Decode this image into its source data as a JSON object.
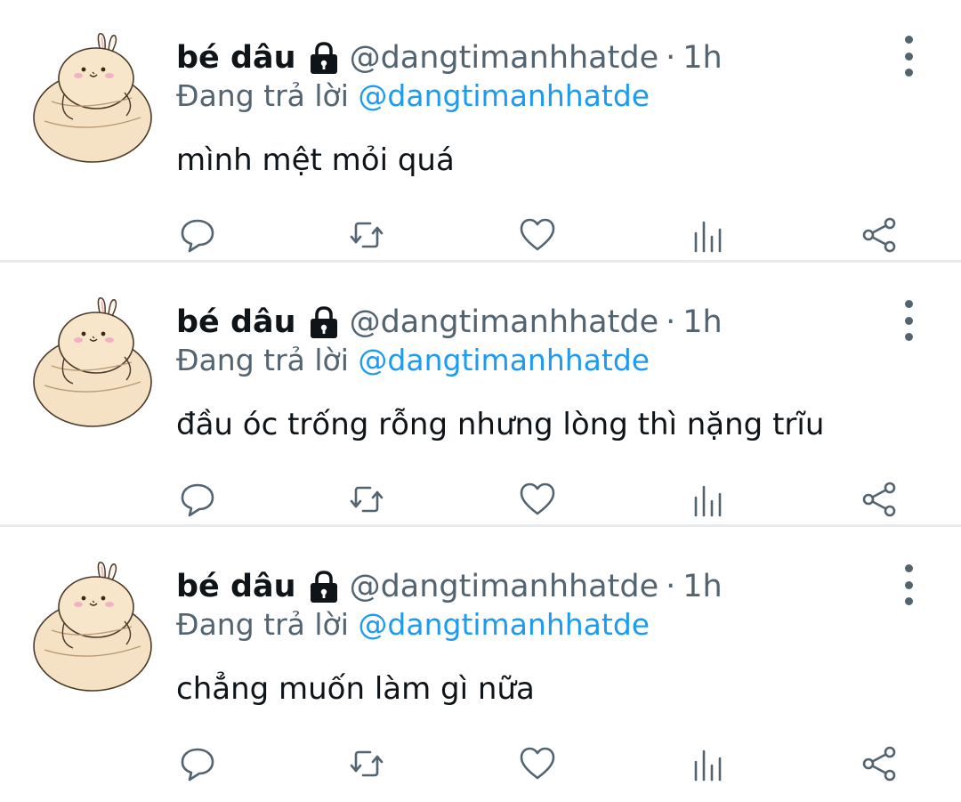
{
  "colors": {
    "text": "#0f1419",
    "secondary": "#536471",
    "link": "#1d9bf0",
    "divider": "#e7e9eb"
  },
  "tweets": [
    {
      "display_name": "bé dâu",
      "handle": "@dangtimanhhatde",
      "separator": "·",
      "time": "1h",
      "reply_prefix": "Đang trả lời",
      "reply_to": "@dangtimanhhatde",
      "text": "mình mệt mỏi quá"
    },
    {
      "display_name": "bé dâu",
      "handle": "@dangtimanhhatde",
      "separator": "·",
      "time": "1h",
      "reply_prefix": "Đang trả lời",
      "reply_to": "@dangtimanhhatde",
      "text": "đầu óc trống rỗng nhưng lòng thì nặng trĩu"
    },
    {
      "display_name": "bé dâu",
      "handle": "@dangtimanhhatde",
      "separator": "·",
      "time": "1h",
      "reply_prefix": "Đang trả lời",
      "reply_to": "@dangtimanhhatde",
      "text": "chẳng muốn làm gì nữa"
    }
  ],
  "icons": {
    "lock": "lock-icon",
    "more": "more-vertical-icon",
    "reply": "reply-icon",
    "retweet": "retweet-icon",
    "like": "heart-icon",
    "stats": "analytics-icon",
    "share": "share-icon"
  }
}
